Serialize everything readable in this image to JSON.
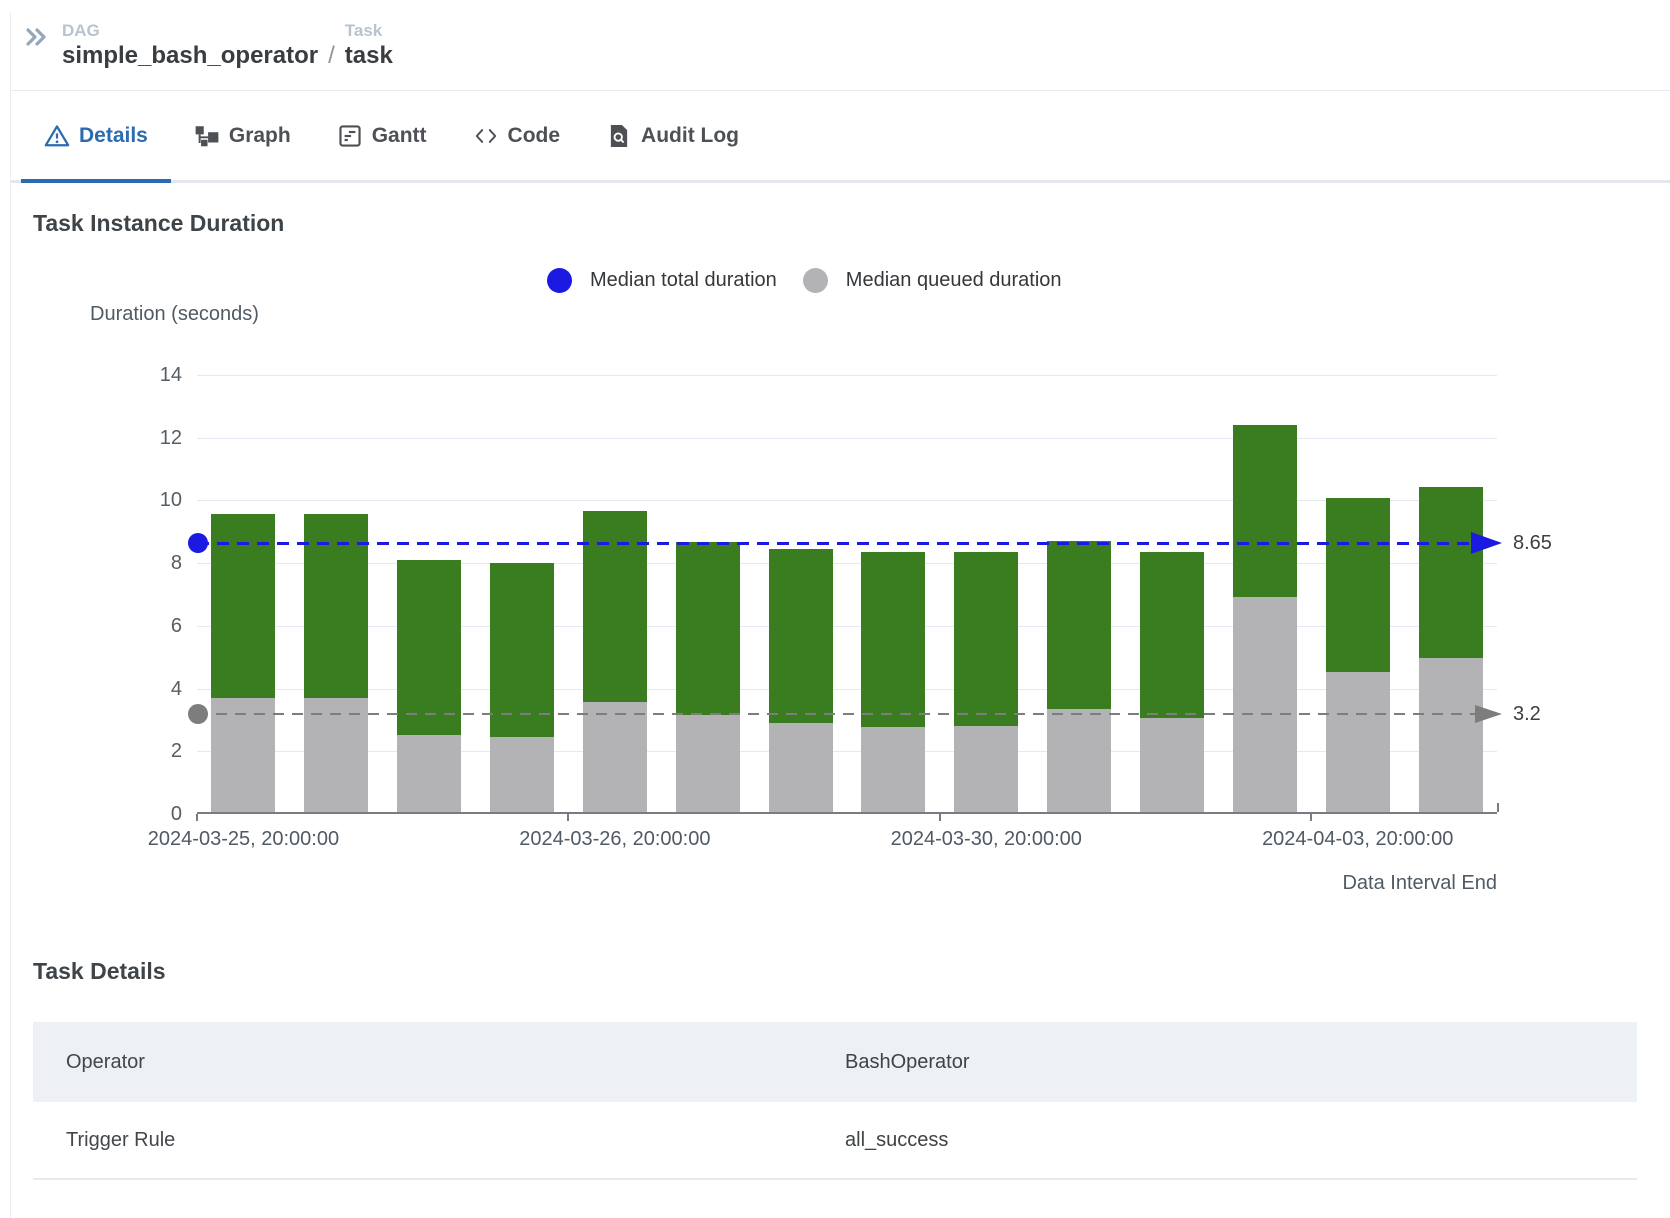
{
  "breadcrumb": {
    "dag_label": "DAG",
    "dag_value": "simple_bash_operator",
    "separator": "/",
    "task_label": "Task",
    "task_value": "task"
  },
  "tabs": [
    {
      "id": "details",
      "label": "Details",
      "icon": "warning-triangle",
      "active": true
    },
    {
      "id": "graph",
      "label": "Graph",
      "icon": "graph-nodes",
      "active": false
    },
    {
      "id": "gantt",
      "label": "Gantt",
      "icon": "gantt-document",
      "active": false
    },
    {
      "id": "code",
      "label": "Code",
      "icon": "code-brackets",
      "active": false
    },
    {
      "id": "audit-log",
      "label": "Audit Log",
      "icon": "file-search",
      "active": false
    }
  ],
  "duration_section": {
    "title": "Task Instance Duration"
  },
  "legend": {
    "items": [
      {
        "name": "Median total duration",
        "color": "#1a1ae0"
      },
      {
        "name": "Median queued duration",
        "color": "#b3b3b5"
      }
    ]
  },
  "chart_data": {
    "type": "bar",
    "stacked": true,
    "title": "Task Instance Duration",
    "ylabel": "Duration (seconds)",
    "xlabel": "Data Interval End",
    "ylim": [
      0,
      14
    ],
    "y_ticks": [
      0,
      2,
      4,
      6,
      8,
      10,
      12,
      14
    ],
    "grid": true,
    "bar_colors": {
      "total": "#3a7d21",
      "queued": "#b3b3b5"
    },
    "bars": {
      "total": [
        9.5,
        9.5,
        8.05,
        7.95,
        9.6,
        8.6,
        8.4,
        8.3,
        8.3,
        8.65,
        8.3,
        12.35,
        10.0,
        10.35
      ],
      "queued": [
        3.65,
        3.65,
        2.45,
        2.4,
        3.5,
        3.1,
        2.85,
        2.7,
        2.75,
        3.3,
        3.0,
        6.85,
        4.45,
        4.9
      ]
    },
    "median_lines": [
      {
        "name": "Median total duration",
        "value": 8.65,
        "label": "8.65",
        "color": "#1a1ae0",
        "style": "blue"
      },
      {
        "name": "Median queued duration",
        "value": 3.2,
        "label": "3.2",
        "color": "#7d7d7d",
        "style": "gray"
      }
    ],
    "x_tick_labels": [
      {
        "slot": 0,
        "label": "2024-03-25, 20:00:00"
      },
      {
        "slot": 4,
        "label": "2024-03-26, 20:00:00"
      },
      {
        "slot": 8,
        "label": "2024-03-30, 20:00:00"
      },
      {
        "slot": 12,
        "label": "2024-04-03, 20:00:00"
      }
    ],
    "x_axis_tick_boundaries": [
      0,
      4,
      8,
      12
    ],
    "legend_position": "top"
  },
  "task_details": {
    "title": "Task Details",
    "rows": [
      {
        "label": "Operator",
        "value": "BashOperator"
      },
      {
        "label": "Trigger Rule",
        "value": "all_success"
      }
    ]
  }
}
